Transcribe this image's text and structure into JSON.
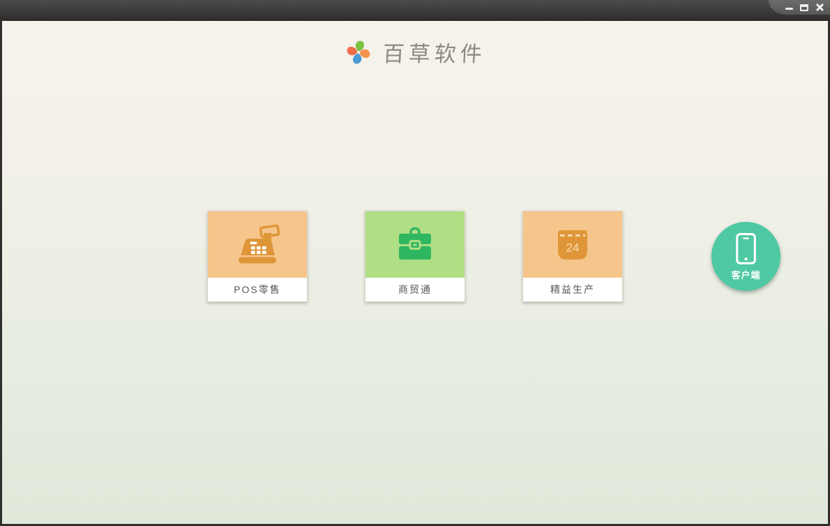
{
  "window": {
    "controls": [
      {
        "name": "minimize"
      },
      {
        "name": "maximize"
      },
      {
        "name": "close"
      }
    ]
  },
  "header": {
    "app_title": "百草软件"
  },
  "products": [
    {
      "label": "POS零售",
      "icon": "cash-register-icon",
      "bg": "#f6c58c",
      "icon_color": "#de9639"
    },
    {
      "label": "商贸通",
      "icon": "briefcase-icon",
      "bg": "#afde84",
      "icon_color": "#2fb660"
    },
    {
      "label": "精益生产",
      "icon": "calendar-icon",
      "day": "24",
      "bg": "#f6c58c",
      "icon_color": "#de9639",
      "icon_light": "#f7ddae"
    }
  ],
  "client": {
    "label": "客户端",
    "icon": "smartphone-icon",
    "bg": "#4fc9a3"
  },
  "theme": {
    "background_top": "#f5f3ec",
    "background_bottom": "#e0e8da",
    "titlebar_dark": "#3b3a38",
    "frame_border": "#2f2f2d",
    "label_text": "#55565a",
    "title_text": "#8b8a82",
    "logo_colors": {
      "green": "#7cc142",
      "orange": "#f6914d",
      "blue": "#4d9bd6",
      "red": "#ef6c48"
    }
  }
}
